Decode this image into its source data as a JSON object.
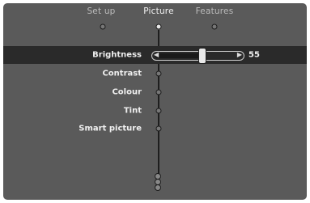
{
  "tabs": [
    {
      "label": "Set up",
      "active": false
    },
    {
      "label": "Picture",
      "active": true
    },
    {
      "label": "Features",
      "active": false
    }
  ],
  "picture_menu": {
    "items": [
      {
        "label": "Brightness",
        "selected": true
      },
      {
        "label": "Contrast",
        "selected": false
      },
      {
        "label": "Colour",
        "selected": false
      },
      {
        "label": "Tint",
        "selected": false
      },
      {
        "label": "Smart picture",
        "selected": false
      }
    ]
  },
  "brightness_slider": {
    "value": "55",
    "level": 0.55
  },
  "colors": {
    "background": "#5a5a5a",
    "highlight": "#2a2a2a",
    "text": "#efefef"
  }
}
